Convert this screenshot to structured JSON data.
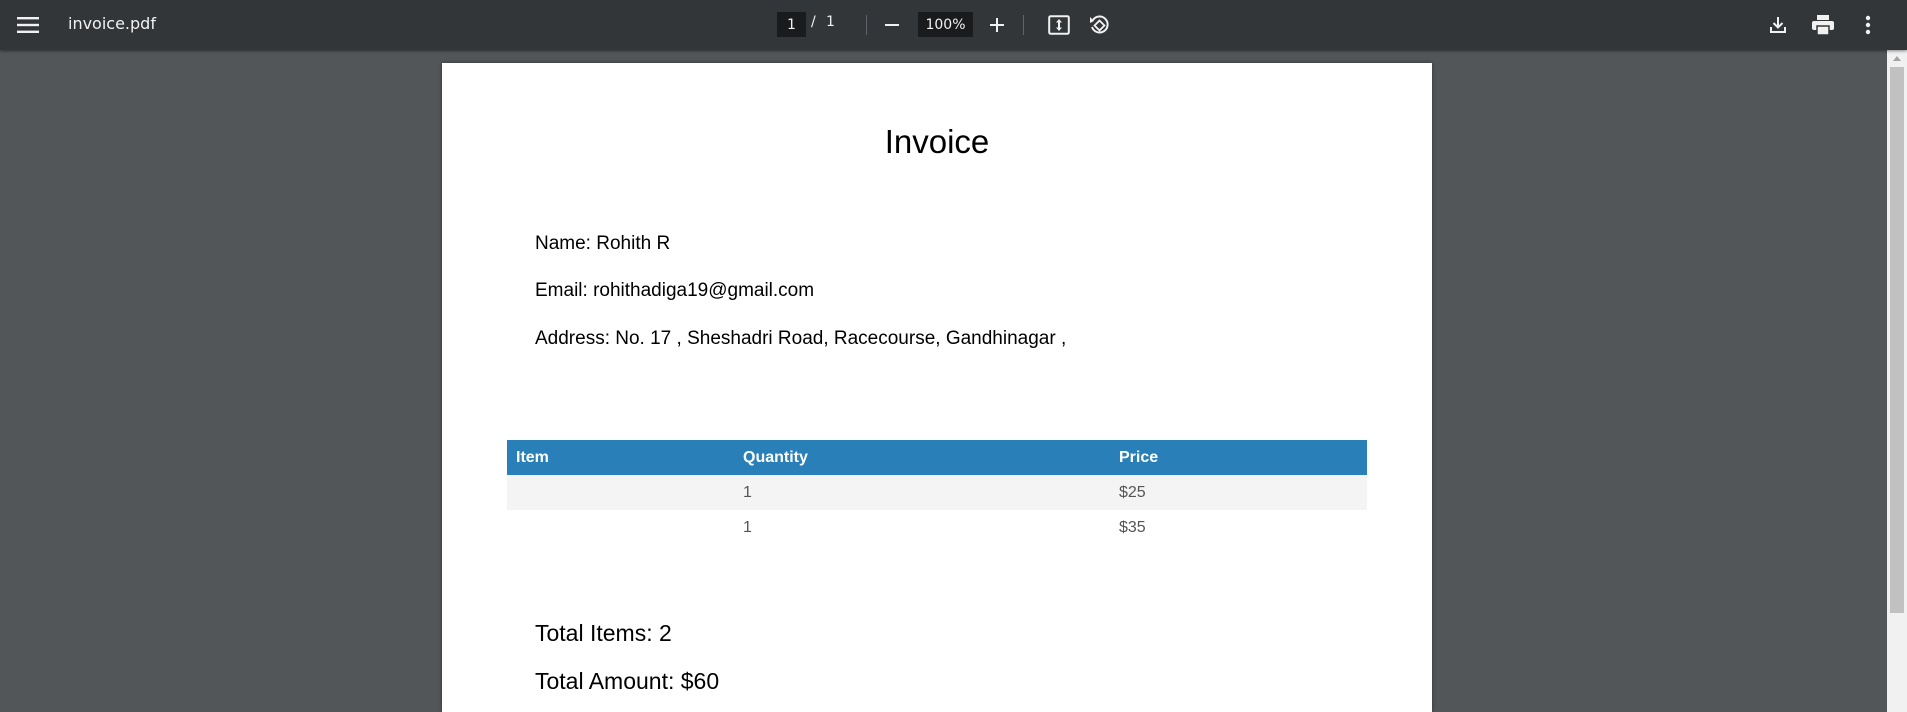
{
  "toolbar": {
    "menu_icon": "hamburger-menu-icon",
    "title": "invoice.pdf",
    "page_current": "1",
    "page_separator": "/",
    "page_total": "1",
    "zoom_out_icon": "minus-icon",
    "zoom_level": "100%",
    "zoom_in_icon": "plus-icon",
    "fit_icon": "fit-to-page-icon",
    "rotate_icon": "rotate-counterclockwise-icon",
    "download_icon": "download-icon",
    "print_icon": "print-icon",
    "more_icon": "more-vert-icon",
    "colors": {
      "bar": "#323639",
      "text": "#f1f1f1"
    }
  },
  "document": {
    "title": "Invoice",
    "name_line": "Name: Rohith R",
    "email_line": "Email: rohithadiga19@gmail.com",
    "address_line": "Address: No. 17 , Sheshadri Road, Racecourse, Gandhinagar ,",
    "table": {
      "header_color": "#2980b9",
      "headers": [
        "Item",
        "Quantity",
        "Price"
      ],
      "rows": [
        [
          "",
          "1",
          "$25"
        ],
        [
          "",
          "1",
          "$35"
        ]
      ]
    },
    "total_items": "Total Items: 2",
    "total_amount": "Total Amount: $60"
  },
  "viewer": {
    "background": "#525659"
  }
}
